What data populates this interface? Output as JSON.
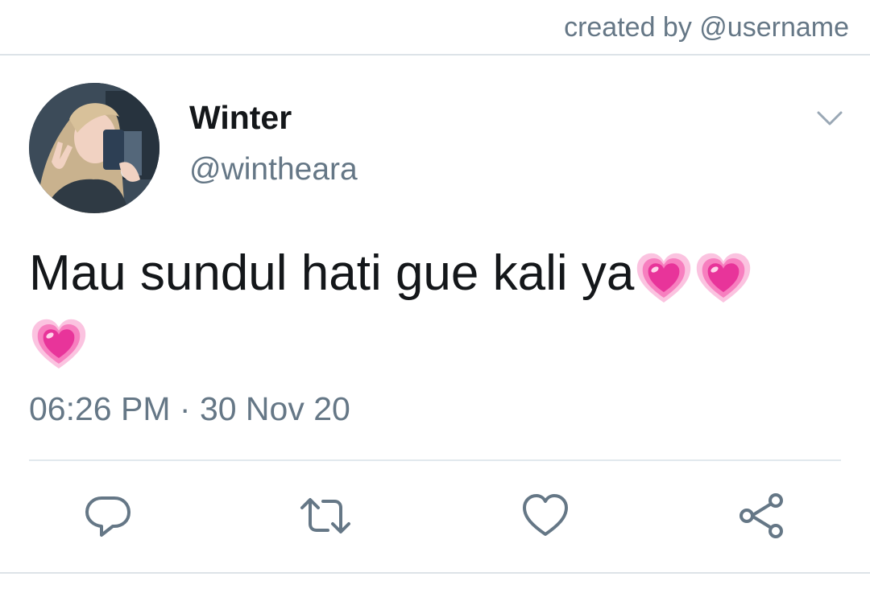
{
  "header": {
    "credit_text": "created by @username"
  },
  "tweet": {
    "display_name": "Winter",
    "handle": "@wintheara",
    "text": "Mau sundul hati gue kali ya",
    "emoji": [
      "growing-heart",
      "growing-heart",
      "growing-heart"
    ],
    "time": "06:26 PM",
    "separator": " · ",
    "date": "30 Nov 20"
  },
  "actions": [
    {
      "name": "reply",
      "icon": "reply-icon"
    },
    {
      "name": "retweet",
      "icon": "retweet-icon"
    },
    {
      "name": "like",
      "icon": "heart-outline-icon"
    },
    {
      "name": "share",
      "icon": "share-icon"
    }
  ],
  "colors": {
    "text_primary": "#14171a",
    "text_secondary": "#657786",
    "divider": "#e1e8ed",
    "heart_pink": "#f03e98"
  }
}
